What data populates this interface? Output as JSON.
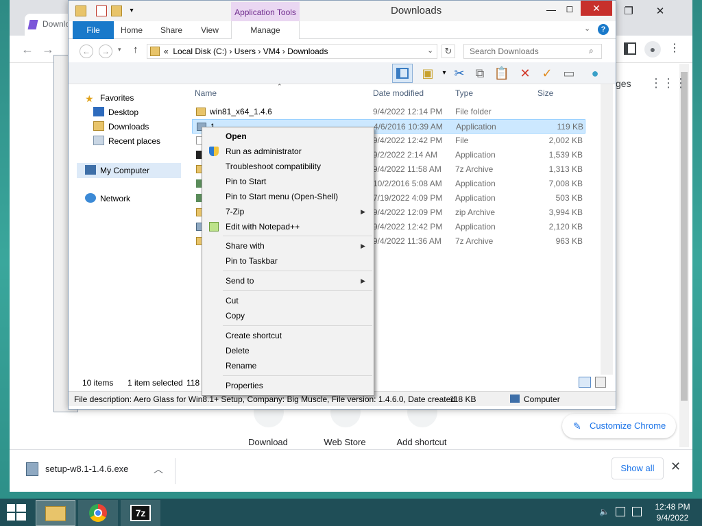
{
  "chrome": {
    "tab_title": "Downloa",
    "apps_label": "ges",
    "customize_label": "Customize Chrome",
    "shortcuts": [
      "Download",
      "Web Store",
      "Add shortcut"
    ],
    "download_file": "setup-w8.1-1.4.6.exe",
    "show_all": "Show all"
  },
  "explorer": {
    "title": "Downloads",
    "app_tools": "Application Tools",
    "tabs": [
      "File",
      "Home",
      "Share",
      "View",
      "Manage"
    ],
    "address": {
      "prefix": "«",
      "parts": [
        "Local Disk (C:)",
        "Users",
        "VM4",
        "Downloads"
      ]
    },
    "search_placeholder": "Search Downloads",
    "nav": {
      "favorites": "Favorites",
      "desktop": "Desktop",
      "downloads": "Downloads",
      "recent": "Recent places",
      "my_computer": "My Computer",
      "network": "Network"
    },
    "columns": {
      "name": "Name",
      "date": "Date modified",
      "type": "Type",
      "size": "Size"
    },
    "files": [
      {
        "name": "win81_x64_1.4.6",
        "date": "9/4/2022 12:14 PM",
        "type": "File folder",
        "size": ""
      },
      {
        "name": "1",
        "date": "4/6/2016 10:39 AM",
        "type": "Application",
        "size": "119 KB"
      },
      {
        "name": "",
        "date": "9/4/2022 12:42 PM",
        "type": "File",
        "size": "2,002 KB"
      },
      {
        "name": "",
        "date": "9/2/2022 2:14 AM",
        "type": "Application",
        "size": "1,539 KB"
      },
      {
        "name": "",
        "date": "9/4/2022 11:58 AM",
        "type": "7z Archive",
        "size": "1,313 KB"
      },
      {
        "name": "",
        "date": "10/2/2016 5:08 AM",
        "type": "Application",
        "size": "7,008 KB"
      },
      {
        "name": "",
        "date": "7/19/2022 4:09 PM",
        "type": "Application",
        "size": "503 KB"
      },
      {
        "name": "",
        "date": "9/4/2022 12:09 PM",
        "type": "zip Archive",
        "size": "3,994 KB"
      },
      {
        "name": "",
        "date": "9/4/2022 12:42 PM",
        "type": "Application",
        "size": "2,120 KB"
      },
      {
        "name": "",
        "date": "9/4/2022 11:36 AM",
        "type": "7z Archive",
        "size": "963 KB"
      }
    ],
    "status": {
      "count": "10 items",
      "selected": "1 item selected",
      "size_partial": "118 I"
    },
    "info_bar": "File description: Aero Glass for Win8.1+ Setup, Company: Big Muscle, File version: 1.4.6.0, Date created:",
    "info_size": "118 KB",
    "info_location": "Computer"
  },
  "context_menu": {
    "open": "Open",
    "run_admin": "Run as administrator",
    "troubleshoot": "Troubleshoot compatibility",
    "pin_start": "Pin to Start",
    "pin_start_menu": "Pin to Start menu (Open-Shell)",
    "zip": "7-Zip",
    "notepadpp": "Edit with Notepad++",
    "share_with": "Share with",
    "pin_taskbar": "Pin to Taskbar",
    "send_to": "Send to",
    "cut": "Cut",
    "copy": "Copy",
    "create_shortcut": "Create shortcut",
    "delete": "Delete",
    "rename": "Rename",
    "properties": "Properties"
  },
  "taskbar": {
    "time": "12:48 PM",
    "date": "9/4/2022",
    "zip_label": "7z"
  },
  "colors": {
    "ribbon_file": "#1979ca",
    "app_tools": "#ead7f2",
    "selection": "#cce8ff",
    "close_red": "#c7302c",
    "chrome_accent": "#1a73e8"
  }
}
